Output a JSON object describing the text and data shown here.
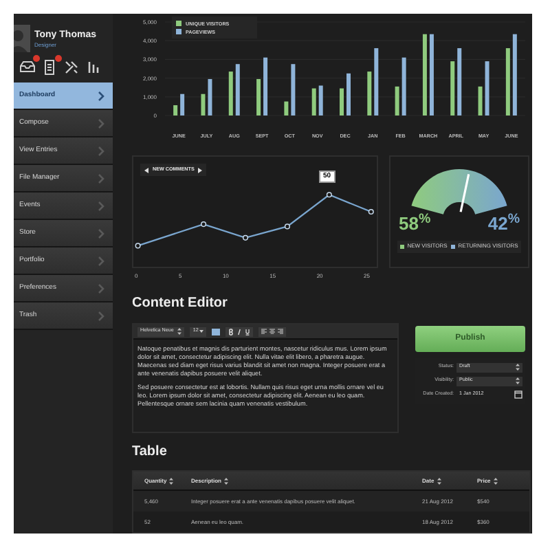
{
  "sidebar": {
    "user": {
      "name": "Tony Thomas",
      "role": "Designer"
    },
    "icons": [
      {
        "badge": true
      },
      {
        "badge": true
      },
      {
        "badge": false
      },
      {
        "badge": false
      }
    ],
    "items": [
      {
        "label": "Dashboard",
        "selected": true
      },
      {
        "label": "Compose",
        "selected": false
      },
      {
        "label": "View Entries",
        "selected": false
      },
      {
        "label": "File Manager",
        "selected": false
      },
      {
        "label": "Events",
        "selected": false
      },
      {
        "label": "Store",
        "selected": false
      },
      {
        "label": "Portfolio",
        "selected": false
      },
      {
        "label": "Preferences",
        "selected": false
      },
      {
        "label": "Trash",
        "selected": false
      }
    ]
  },
  "visitors_chart": {
    "chart_data": {
      "type": "bar",
      "grid": true,
      "legend": "upper left",
      "categories": [
        "JUNE",
        "JULY",
        "AUG",
        "SEPT",
        "OCT",
        "NOV",
        "DEC",
        "JAN",
        "FEB",
        "MARCH",
        "APRIL",
        "MAY",
        "JUNE"
      ],
      "ylim": [
        0,
        5000
      ],
      "yticks": [
        {
          "value": 0,
          "label": "0"
        },
        {
          "value": 1000,
          "label": "1,000"
        },
        {
          "value": 2000,
          "label": "2,000"
        },
        {
          "value": 3000,
          "label": "3,000"
        },
        {
          "value": 4000,
          "label": "4,000"
        },
        {
          "value": 5000,
          "label": "5,000"
        }
      ],
      "series": [
        {
          "name": "UNIQUE VISITORS",
          "color": "#8fcb7e",
          "values": [
            550,
            1150,
            2350,
            1950,
            750,
            1450,
            1450,
            2350,
            1550,
            4350,
            2900,
            1550,
            3600
          ]
        },
        {
          "name": "PAGEVIEWS",
          "color": "#8fb4d9",
          "values": [
            1150,
            1950,
            2750,
            3100,
            2750,
            1600,
            2250,
            3600,
            3100,
            4350,
            3600,
            2900,
            4350
          ]
        }
      ]
    }
  },
  "comments_chart": {
    "title": "NEW COMMENTS",
    "highlight": "50",
    "xticks": [
      "0",
      "5",
      "10",
      "15",
      "20",
      "25"
    ]
  },
  "visitors_gauge": {
    "level": 0.58,
    "new_share": "58$^{%}$",
    "returning_share": "42$^{%}$",
    "legend": [
      {
        "label": "NEW VISITORS",
        "color": "#8fcb7e"
      },
      {
        "label": "RETURNING VISITORS",
        "color": "#8fb4d9"
      }
    ]
  },
  "content_editor": {
    "title": "Content Editor",
    "toolbar": {
      "font": "Helvetica Neue",
      "size": "12"
    },
    "paragraphs": [
      "Natoque penatibus et magnis dis parturient montes, nascetur ridiculus mus. Lorem ipsum dolor sit amet, consectetur adipiscing elit. Nulla vitae elit libero, a pharetra augue. Maecenas sed diam eget risus varius blandit sit amet non magna. Integer posuere erat a ante venenatis dapibus posuere velit aliquet.",
      "Sed posuere consectetur est at lobortis. Nullam quis risus eget urna mollis ornare vel eu leo. Lorem ipsum dolor sit amet, consectetur adipiscing elit. Aenean eu leo quam. Pellentesque ornare sem lacinia quam venenatis vestibulum."
    ],
    "publish": "Publish",
    "fields": [
      {
        "label": "Status:",
        "value": "Draft",
        "kind": "select"
      },
      {
        "label": "Visibility:",
        "value": "Public",
        "kind": "select"
      },
      {
        "label": "Date Created:",
        "value": "1 Jan 2012",
        "kind": "date"
      }
    ]
  },
  "table": {
    "title": "Table",
    "columns": [
      "Quantity",
      "Description",
      "Date",
      "Price"
    ],
    "rows": [
      [
        "5,460",
        "Integer posuere erat a ante venenatis dapibus posuere velit aliquet.",
        "21 Aug 2012",
        "$540"
      ],
      [
        "52",
        "Aenean eu leo quam.",
        "18 Aug 2012",
        "$360"
      ]
    ]
  }
}
